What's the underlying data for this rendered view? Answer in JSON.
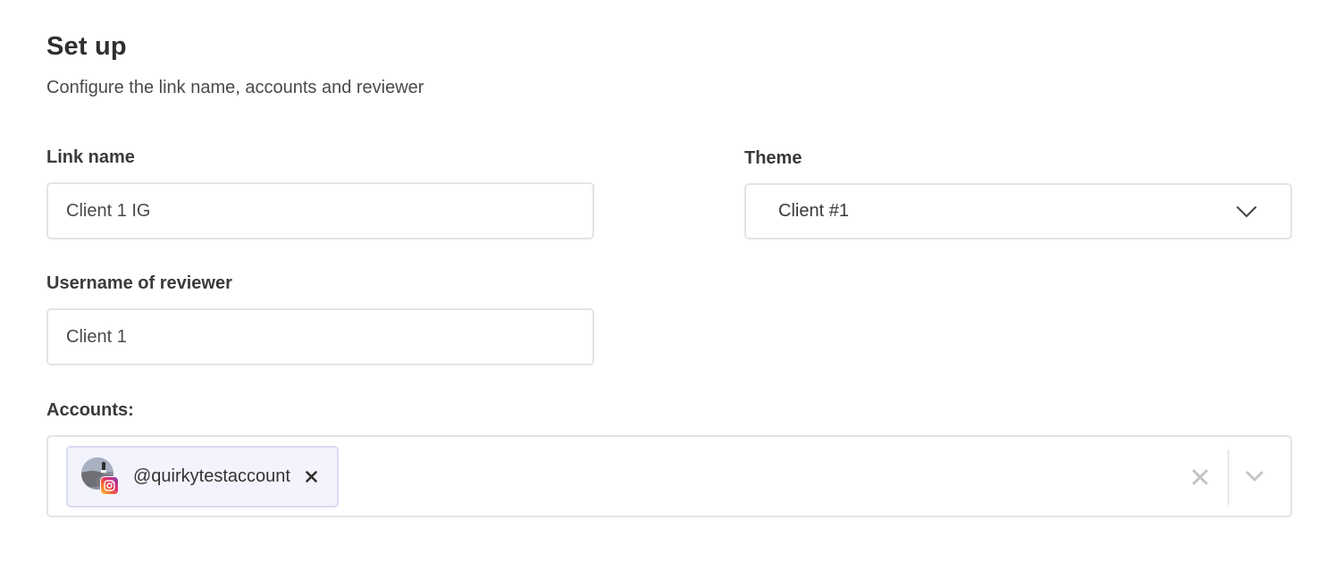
{
  "header": {
    "title": "Set up",
    "subtitle": "Configure the link name, accounts and reviewer"
  },
  "form": {
    "link_name": {
      "label": "Link name",
      "value": "Client 1 IG"
    },
    "theme": {
      "label": "Theme",
      "selected": "Client #1"
    },
    "reviewer": {
      "label": "Username of reviewer",
      "value": "Client 1"
    },
    "accounts": {
      "label": "Accounts:",
      "selected": [
        {
          "handle": "@quirkytestaccount",
          "platform_icon": "instagram-icon"
        }
      ]
    }
  },
  "colors": {
    "chip_background": "#f3f3fd",
    "chip_border": "#d9dbf3",
    "input_border": "#e4e4e4",
    "text_primary": "#333333"
  }
}
